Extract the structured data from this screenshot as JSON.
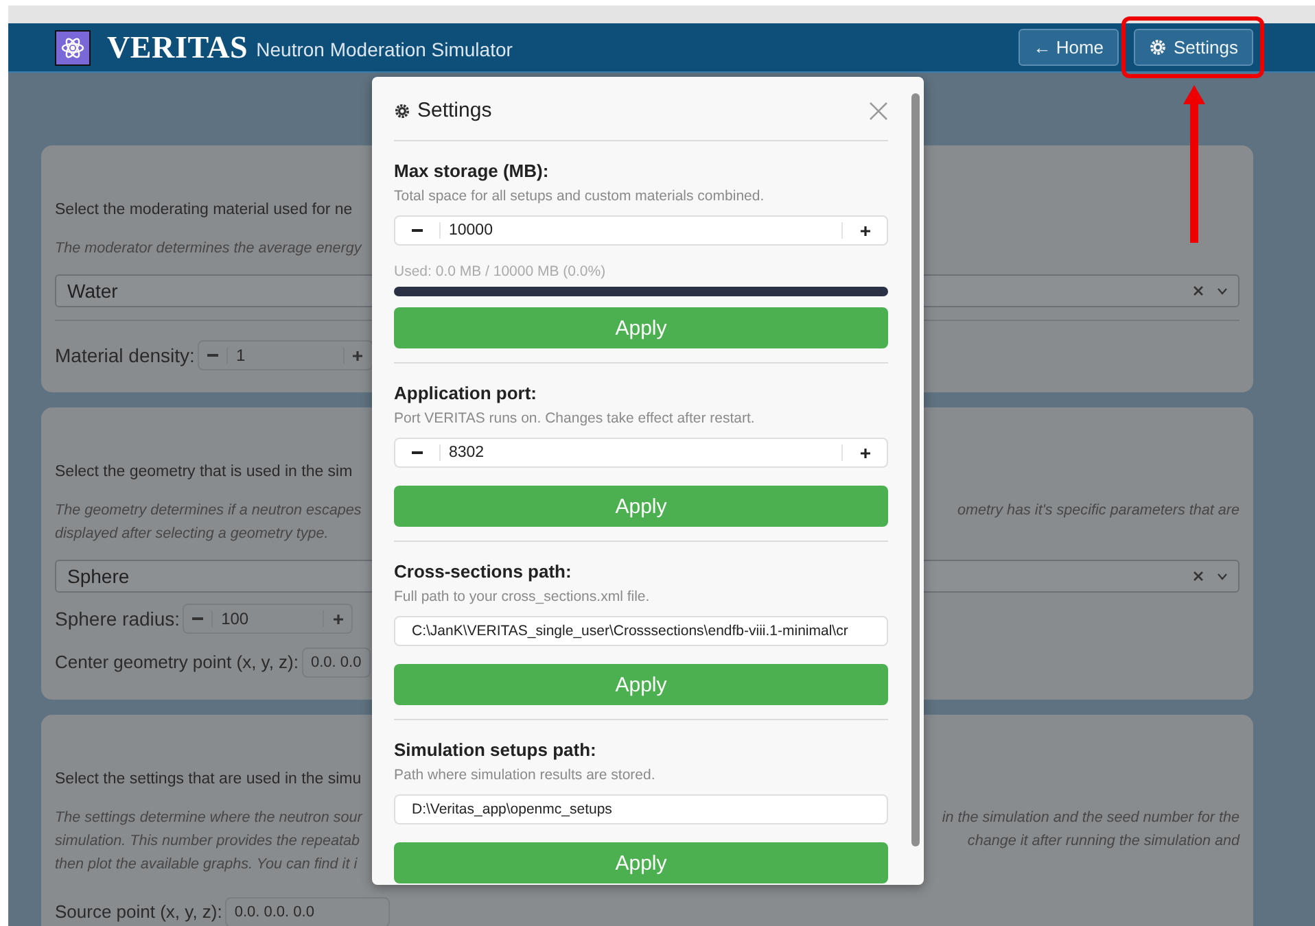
{
  "header": {
    "logo": "VERITAS",
    "subtitle": "Neutron Moderation Simulator",
    "buttons": [
      {
        "kind": "home",
        "label": "← Home",
        "highlighted": false
      },
      {
        "kind": "settings",
        "label": "Settings",
        "highlighted": true
      }
    ]
  },
  "cards": [
    {
      "rows": [
        {
          "kind": "text",
          "left": "Select the moderating material used for ne"
        },
        {
          "kind": "hint",
          "left": "The moderator determines the average energy"
        },
        {
          "kind": "select",
          "value": "Water"
        },
        {
          "kind": "divider"
        },
        {
          "kind": "stepper",
          "label": "Material density:",
          "value": "1"
        }
      ]
    },
    {
      "rows": [
        {
          "kind": "text",
          "left": "Select the geometry that is used in the sim"
        },
        {
          "kind": "hint",
          "left": "The geometry determines if a neutron escapes",
          "right": "ometry has it's specific parameters that are"
        },
        {
          "kind": "hint",
          "left": "displayed after selecting a geometry type."
        },
        {
          "kind": "select",
          "value": "Sphere"
        },
        {
          "kind": "stepper",
          "label": "Sphere radius:",
          "value": "100"
        },
        {
          "kind": "coords",
          "label": "Center geometry point (x, y, z):",
          "value": "0.0. 0.0"
        }
      ]
    },
    {
      "rows": [
        {
          "kind": "text",
          "left": "Select the settings that are used in the simu"
        },
        {
          "kind": "hint",
          "left": "The settings determine where the neutron sour",
          "right": "in the simulation and the seed number for the"
        },
        {
          "kind": "hint",
          "left": "simulation. This number provides the repeatab",
          "right": "change it after running the simulation and"
        },
        {
          "kind": "hint",
          "left": "then plot the available graphs. You can find it i"
        },
        {
          "kind": "coords",
          "label": "Source point (x, y, z):",
          "value": "0.0. 0.0. 0.0"
        }
      ]
    }
  ],
  "modal": {
    "title": "Settings",
    "sections": [
      {
        "kind": "stepper",
        "title": "Max storage (MB):",
        "description": "Total space for all setups and custom materials combined.",
        "value": "10000",
        "usage": {
          "text": "Used: 0.0 MB / 10000 MB (0.0%)",
          "level": 0
        },
        "button": "Apply"
      },
      {
        "kind": "stepper",
        "title": "Application port:",
        "description": "Port VERITAS runs on. Changes take effect after restart.",
        "value": "8302",
        "button": "Apply"
      },
      {
        "kind": "path",
        "title": "Cross-sections path:",
        "description": "Full path to your cross_sections.xml file.",
        "value": "C:\\JanK\\VERITAS_single_user\\Crosssections\\endfb-viii.1-minimal\\cr",
        "button": "Apply"
      },
      {
        "kind": "path",
        "title": "Simulation setups path:",
        "description": "Path where simulation results are stored.",
        "value": "D:\\Veritas_app\\openmc_setups",
        "button": "Apply"
      }
    ]
  }
}
